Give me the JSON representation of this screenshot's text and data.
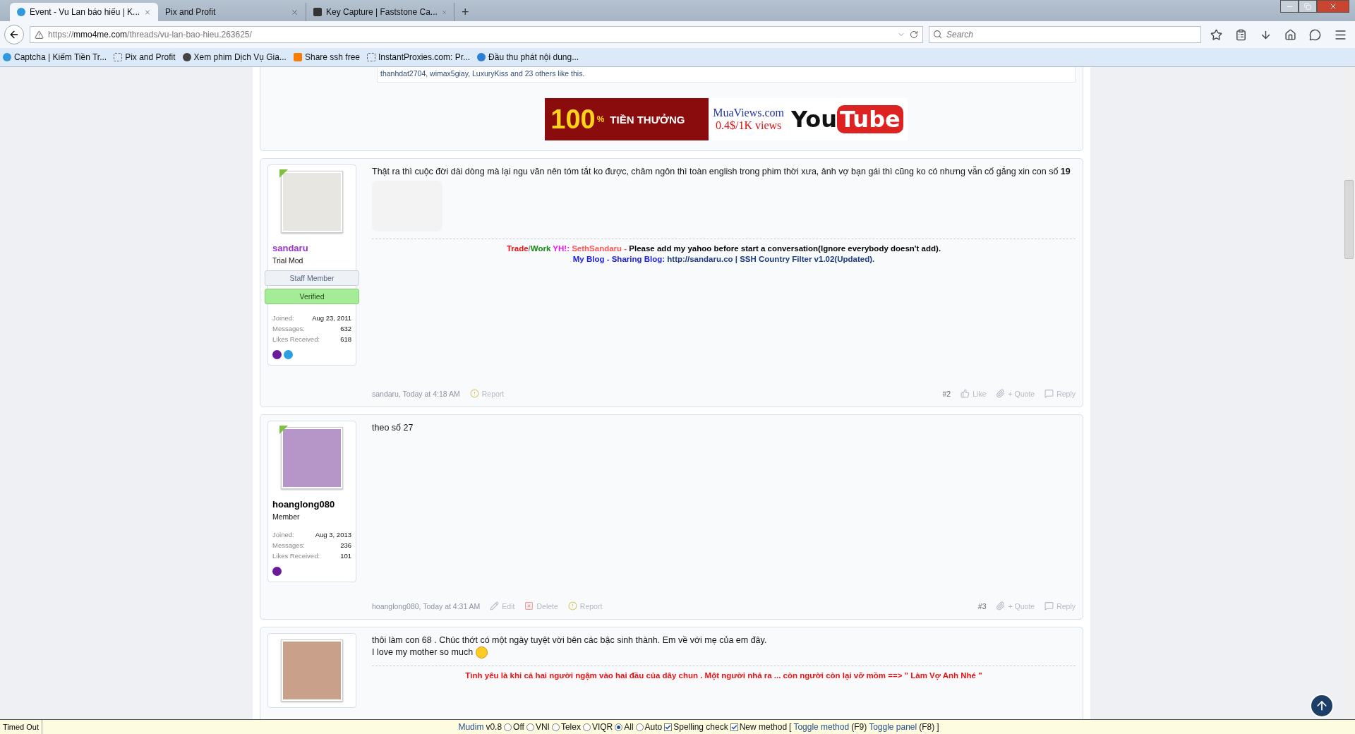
{
  "browser": {
    "tabs": [
      {
        "title": "Event - Vu Lan báo hiếu | K...",
        "selected": true
      },
      {
        "title": "Pix and Profit",
        "selected": false
      },
      {
        "title": "Key Capture | Faststone Ca...",
        "selected": false
      }
    ],
    "new_tab": "+",
    "url": {
      "host": "mmo4me.com",
      "scheme": "https://",
      "path": "/threads/vu-lan-bao-hieu.263625/"
    },
    "search": {
      "placeholder": "Search"
    },
    "bookmarks": [
      {
        "label": "Captcha | Kiếm Tiền Tr..."
      },
      {
        "label": "Pix and Profit"
      },
      {
        "label": "Xem phim Dịch Vụ Gia..."
      },
      {
        "label": "Share ssh free"
      },
      {
        "label": "InstantProxies.com: Pr..."
      },
      {
        "label": "Đầu thu phát nội dung..."
      }
    ]
  },
  "previous_post": {
    "likes": "thanhdat2704, wimax5giay, LuxuryKiss and 23 others like this.",
    "banner": {
      "big": "100",
      "percent": "%",
      "bonus": "TIỀN THƯỞNG",
      "site": "MuaViews.com",
      "price": "0.4$/1K views",
      "brand_a": "You",
      "brand_b": "Tube"
    }
  },
  "posts": [
    {
      "user": {
        "name": "sandaru",
        "color": "#9933cc",
        "title": "Trial Mod",
        "staff": "Staff Member",
        "verified": "Verified",
        "online": true,
        "stats": [
          {
            "label": "Joined:",
            "value": "Aug 23, 2011"
          },
          {
            "label": "Messages:",
            "value": "632"
          },
          {
            "label": "Likes Received:",
            "value": "618"
          }
        ]
      },
      "body": [
        "Thật ra thì cuộc đời dài dòng mà lại ngu văn nên tóm tắt ko được, châm ngôn thì toàn english trong phim thời xưa, ảnh vợ bạn gái thì cũng ko có nhưng vẫn cố gắng xin con số **19**"
      ],
      "sticker": true,
      "signature": [
        [
          {
            "text": "Trade",
            "color": "#ee1111"
          },
          {
            "text": "/",
            "color": "#888888"
          },
          {
            "text": "Work",
            "color": "#118811"
          },
          {
            "text": " YH!:",
            "color": "#ee11ee"
          },
          {
            "text": " SethSandaru -",
            "color": "#ff5555"
          },
          {
            "text": " Please add my yahoo before start a conversation(Ignore everybody doesn't add).",
            "color": "#000000"
          }
        ],
        [
          {
            "text": "My Blog - Sharing Blog:",
            "color": "#1a1aee"
          },
          {
            "text": " http://sandaru.co | SSH Country Filter v1.02(Updated).",
            "color": "#1a3a8a"
          }
        ]
      ],
      "meta": "sandaru, Today at 4:18 AM",
      "left_actions": [
        {
          "kind": "report",
          "label": "Report"
        }
      ],
      "number": "#2",
      "right_actions": [
        {
          "kind": "like",
          "label": "Like"
        },
        {
          "kind": "quote",
          "label": "+ Quote"
        },
        {
          "kind": "reply",
          "label": "Reply"
        }
      ]
    },
    {
      "user": {
        "name": "hoanglong080",
        "color": "#000000",
        "title": "Member",
        "online": true,
        "stats": [
          {
            "label": "Joined:",
            "value": "Aug 3, 2013"
          },
          {
            "label": "Messages:",
            "value": "236"
          },
          {
            "label": "Likes Received:",
            "value": "101"
          }
        ]
      },
      "body": [
        "theo số 27"
      ],
      "meta": "hoanglong080, Today at 4:31 AM",
      "left_actions": [
        {
          "kind": "edit",
          "label": "Edit"
        },
        {
          "kind": "delete",
          "label": "Delete"
        },
        {
          "kind": "report",
          "label": "Report"
        }
      ],
      "number": "#3",
      "right_actions": [
        {
          "kind": "quote",
          "label": "+ Quote"
        },
        {
          "kind": "reply",
          "label": "Reply"
        }
      ]
    },
    {
      "user": {
        "online": false
      },
      "body": [
        "thôi làm con 68 . Chúc thớt có một ngày tuyệt vời bên các bậc sinh thành. Em về với mẹ của em đây.",
        "I love my mother so much"
      ],
      "smiley": true,
      "signature": [
        [
          {
            "text": "Tình yêu là khi cả hai người ngậm vào hai đầu của dây chun . Một người nhả ra ... còn người còn lại vỡ mồm ==> \" Làm Vợ Anh Nhé \"",
            "color": "#ee1111"
          }
        ]
      ]
    }
  ],
  "mudim": {
    "name": "Mudim",
    "version": "v0.8",
    "methods": [
      {
        "label": "Off",
        "selected": false
      },
      {
        "label": "VNI",
        "selected": false
      },
      {
        "label": "Telex",
        "selected": false
      },
      {
        "label": "VIQR",
        "selected": false
      },
      {
        "label": "All",
        "selected": true
      },
      {
        "label": "Auto",
        "selected": false
      }
    ],
    "options": [
      {
        "label": "Spelling check",
        "checked": true
      },
      {
        "label": "New method",
        "checked": true
      }
    ],
    "open": "[",
    "toggle_method": "Toggle method",
    "method_key": "(F9)",
    "toggle_panel": "Toggle panel",
    "panel_key": "(F8)",
    "close": "]"
  },
  "status": "Timed Out"
}
